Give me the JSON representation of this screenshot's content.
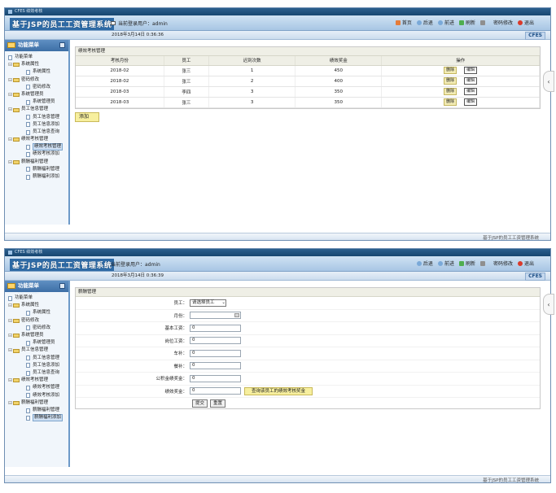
{
  "app": {
    "window_title": "CFES 绩效考核",
    "logo": "基于JSP的员工工资管理系统",
    "current_user_label": "当前登录用户：admin",
    "cfes_badge": "CFES",
    "footer_text": "基于JSP的员工工资管理系统",
    "nav": {
      "home": "首页",
      "back": "后退",
      "forward": "前进",
      "refresh": "刷新",
      "password": "密码修改",
      "logout": "退出"
    },
    "sidebar": {
      "title": "功能菜单",
      "subtitle": "FUNCTION MENU",
      "root": "功能菜单",
      "groups": [
        {
          "label": "系统属性",
          "items": [
            "系统属性"
          ]
        },
        {
          "label": "密码修改",
          "items": [
            "密码修改"
          ]
        },
        {
          "label": "系统管理员",
          "items": [
            "系统管理员"
          ]
        },
        {
          "label": "员工信息管理",
          "items": [
            "员工信息管理",
            "员工信息添加",
            "员工信息查询"
          ]
        },
        {
          "label": "绩效考核管理",
          "items": [
            "绩效考核管理",
            "绩效考核添加"
          ]
        },
        {
          "label": "薪酬福利管理",
          "items": [
            "薪酬福利管理",
            "薪酬福利添加"
          ]
        }
      ]
    }
  },
  "screen1": {
    "date": "2018年3月14日 0:36:36",
    "panel_title": "绩效考核管理",
    "columns": [
      "考核月份",
      "员工",
      "迟到次数",
      "绩效奖金",
      "操作"
    ],
    "rows": [
      [
        "2018-02",
        "张三",
        "1",
        "450"
      ],
      [
        "2018-02",
        "张三",
        "2",
        "400"
      ],
      [
        "2018-03",
        "李四",
        "3",
        "350"
      ],
      [
        "2018-03",
        "张三",
        "3",
        "350"
      ]
    ],
    "delete_label": "删除",
    "edit_label": "编辑",
    "add_label": "添加"
  },
  "screen2": {
    "date": "2018年3月14日 0:36:39",
    "panel_title": "薪酬管理",
    "fields": {
      "employee_label": "员工：",
      "employee_select": "请选择员工",
      "month_label": "月份：",
      "month_value": "",
      "base_label": "基本工资：",
      "base_value": "0",
      "post_label": "岗位工资：",
      "post_value": "0",
      "car_label": "车补：",
      "car_value": "0",
      "meal_label": "餐补：",
      "meal_value": "0",
      "fund_label": "公积金绩奖金：",
      "fund_value": "0",
      "perf_label": "绩效奖金：",
      "perf_value": "0"
    },
    "query_button": "查询该员工的绩效考核奖金",
    "submit": "提交",
    "reset": "重置"
  }
}
